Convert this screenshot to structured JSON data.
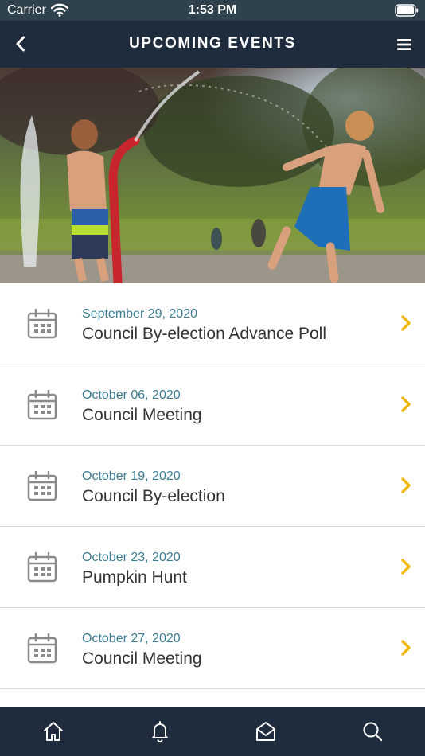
{
  "status_bar": {
    "carrier": "Carrier",
    "time": "1:53 PM"
  },
  "nav": {
    "title": "UPCOMING EVENTS",
    "left_icon": "back-chevron-icon",
    "right_icon": "hamburger-menu-icon"
  },
  "hero": {
    "alt": "Children playing in a splash pad fountain"
  },
  "events": [
    {
      "date": "September 29, 2020",
      "title": "Council By-election Advance Poll"
    },
    {
      "date": "October 06, 2020",
      "title": "Council Meeting"
    },
    {
      "date": "October 19, 2020",
      "title": "Council By-election"
    },
    {
      "date": "October 23, 2020",
      "title": "Pumpkin Hunt"
    },
    {
      "date": "October 27, 2020",
      "title": "Council Meeting"
    }
  ],
  "tab_bar": {
    "items": [
      "home-icon",
      "bell-icon",
      "mail-open-icon",
      "search-icon"
    ]
  },
  "colors": {
    "nav_background": "#1f2c3d",
    "status_background": "#30414e",
    "date_text": "#3a7c92",
    "title_text": "#333333",
    "chevron": "#f2b705",
    "icon_gray": "#8a8a8a"
  }
}
